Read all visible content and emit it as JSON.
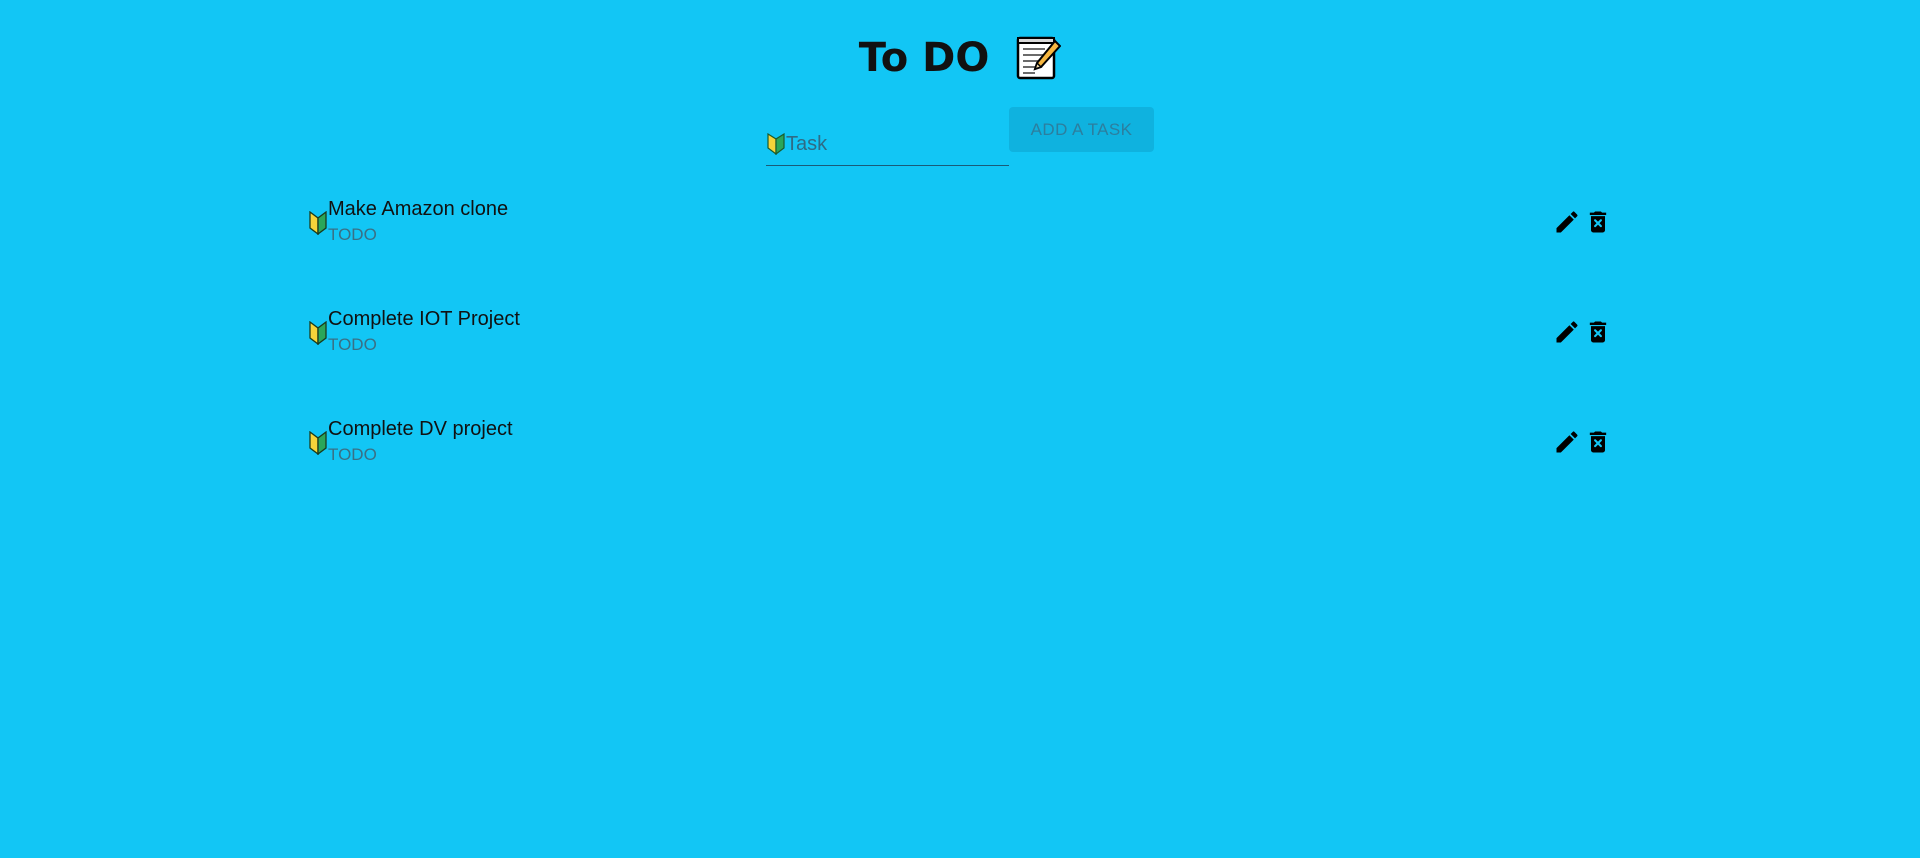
{
  "header": {
    "title": "To DO",
    "title_icon": "memo-icon"
  },
  "form": {
    "task_placeholder": "Task",
    "task_value": "",
    "add_button_label": "ADD A TASK",
    "field_icon": "beginner-leaf-icon"
  },
  "tasks": [
    {
      "name": "Make Amazon clone",
      "status": "TODO"
    },
    {
      "name": "Complete IOT Project",
      "status": "TODO"
    },
    {
      "name": "Complete DV project",
      "status": "TODO"
    }
  ],
  "task_icons": {
    "leaf": "beginner-leaf-icon",
    "edit": "pencil-icon",
    "delete": "trash-icon"
  },
  "colors": {
    "background": "#12c6f5",
    "button_background": "#0fb2df",
    "button_text": "#2c7e9e",
    "status_text": "#3a7086",
    "leaf_yellow": "#f5d33a",
    "leaf_green": "#2aa65a"
  }
}
